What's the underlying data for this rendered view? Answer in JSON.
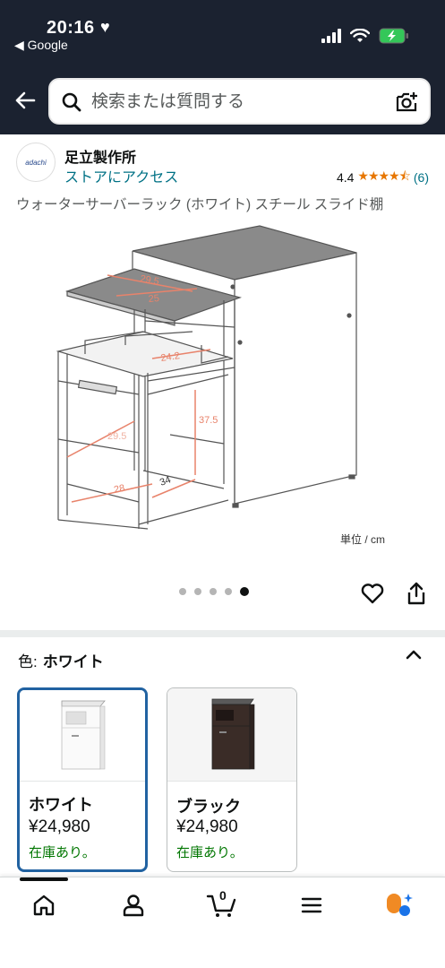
{
  "status_bar": {
    "time": "20:16",
    "back_app": "◀ Google"
  },
  "search": {
    "placeholder": "検索または質問する"
  },
  "brand": {
    "logo_text": "adachi",
    "name": "足立製作所",
    "store_link": "ストアにアクセス",
    "rating_value": "4.4",
    "stars": "★★★★⯪",
    "rating_count": "(6)"
  },
  "product": {
    "title": "ウォーターサーバーラック (ホワイト) スチール スライド棚",
    "dimensions": [
      "29.5",
      "25",
      "24.2",
      "37.5",
      "29.5",
      "28",
      "34"
    ],
    "unit_label": "単位 / cm",
    "image_count": 5,
    "active_image_index": 5
  },
  "variant_selector": {
    "label": "色:",
    "selected_value": "ホワイト",
    "options": [
      {
        "name": "ホワイト",
        "price": "¥24,980",
        "stock": "在庫あり。",
        "selected": true
      },
      {
        "name": "ブラック",
        "price": "¥24,980",
        "stock": "在庫あり。",
        "selected": false
      }
    ]
  },
  "bottom_nav": {
    "cart_count": "0",
    "items": [
      "home-icon",
      "account-icon",
      "cart-icon",
      "menu-icon",
      "rufus-icon"
    ]
  },
  "colors": {
    "header_bg": "#1b2230",
    "link": "#007185",
    "star": "#e77600",
    "stock_green": "#007600",
    "selected_border": "#2162a1",
    "battery_green": "#34c759",
    "rufus_orange": "#f08a24",
    "rufus_blue": "#1a73e8"
  }
}
